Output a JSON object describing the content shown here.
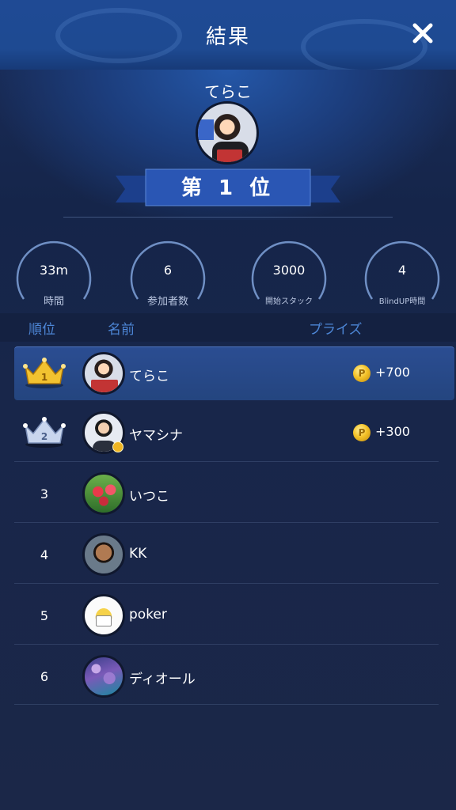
{
  "header": {
    "title": "結果"
  },
  "winner": {
    "name": "てらこ",
    "rank_text": "第 1 位"
  },
  "stats": [
    {
      "value": "33m",
      "label": "時間"
    },
    {
      "value": "6",
      "label": "参加者数"
    },
    {
      "value": "3000",
      "label": "開始スタック"
    },
    {
      "value": "4",
      "label": "BlindUP時間"
    }
  ],
  "table": {
    "headers": {
      "rank": "順位",
      "name": "名前",
      "prize": "プライズ"
    },
    "rows": [
      {
        "rank": "1",
        "name": "てらこ",
        "prize": "+700",
        "medal": "gold-crown"
      },
      {
        "rank": "2",
        "name": "ヤマシナ",
        "prize": "+300",
        "medal": "silver-crown"
      },
      {
        "rank": "3",
        "name": "いつこ",
        "prize": ""
      },
      {
        "rank": "4",
        "name": "KK",
        "prize": ""
      },
      {
        "rank": "5",
        "name": "poker",
        "prize": ""
      },
      {
        "rank": "6",
        "name": "ディオール",
        "prize": ""
      }
    ]
  },
  "coin_symbol": "P",
  "colors": {
    "accent": "#4d86d6",
    "highlight_row": "#2b4d92",
    "gold": "#f4c228",
    "banner": "#2a56b4"
  }
}
